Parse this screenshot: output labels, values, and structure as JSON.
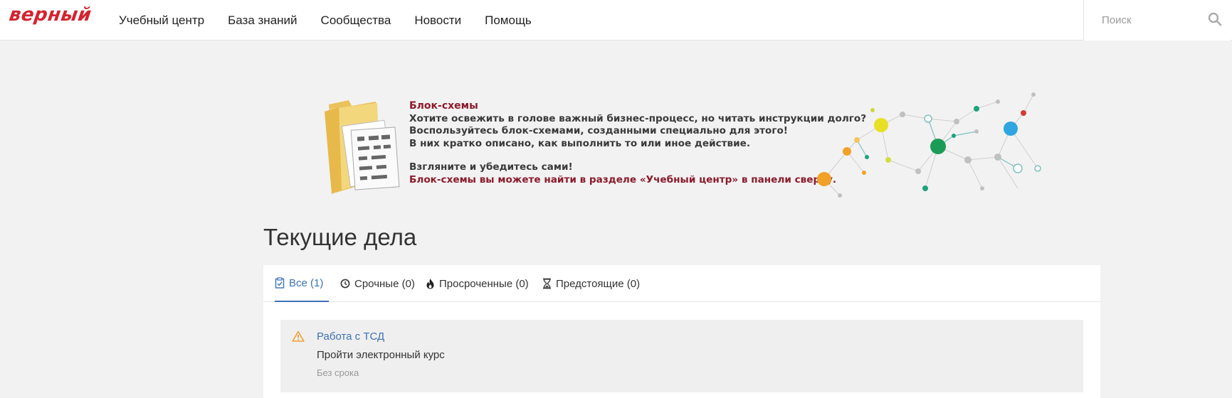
{
  "header": {
    "logo": "верный",
    "nav": [
      {
        "label": "Учебный центр"
      },
      {
        "label": "База знаний"
      },
      {
        "label": "Сообщества"
      },
      {
        "label": "Новости"
      },
      {
        "label": "Помощь"
      }
    ],
    "search": {
      "placeholder": "Поиск",
      "value": ""
    }
  },
  "banner": {
    "title": "Блок-схемы",
    "lines": [
      "Хотите освежить в голове важный бизнес-процесс, но читать инструкции долго?",
      "Воспользуйтесь блок-схемами, созданными специально для этого!",
      "В них кратко описано, как выполнить то или иное действие."
    ],
    "cta_line1": "Взгляните и убедитесь сами!",
    "cta_line2": "Блок-схемы вы можете найти в разделе «Учебный центр» в панели сверху."
  },
  "current": {
    "title": "Текущие дела",
    "tabs": [
      {
        "label": "Все (1)",
        "icon": "clipboard-check-icon",
        "active": true
      },
      {
        "label": "Срочные (0)",
        "icon": "clock-icon",
        "active": false
      },
      {
        "label": "Просроченные (0)",
        "icon": "fire-icon",
        "active": false
      },
      {
        "label": "Предстоящие (0)",
        "icon": "hourglass-icon",
        "active": false
      }
    ],
    "tasks": [
      {
        "title": "Работа с ТСД",
        "description": "Пройти электронный курс",
        "deadline": "Без срока",
        "icon": "warning-icon"
      }
    ]
  },
  "colors": {
    "brand_red": "#d5232f",
    "link_blue": "#3d72b5",
    "banner_red": "#8b1a2b",
    "warning_orange": "#f0a030"
  }
}
